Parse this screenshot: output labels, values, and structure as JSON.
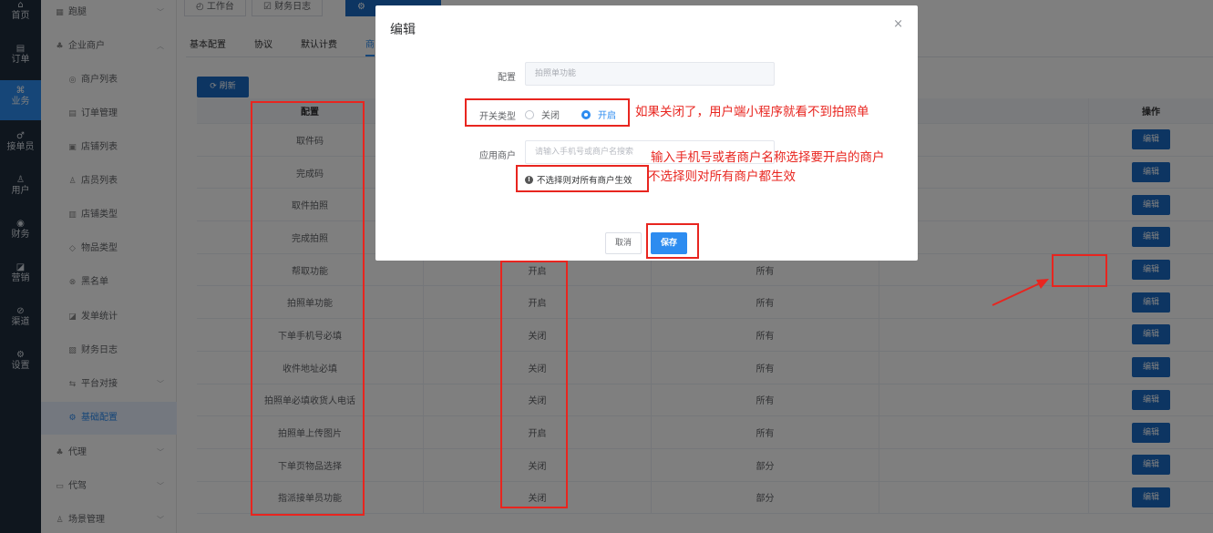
{
  "mainbar": {
    "items": [
      {
        "icon": "home-icon",
        "glyph": "⌂",
        "label": "首页"
      },
      {
        "icon": "order-icon",
        "glyph": "▤",
        "label": "订单"
      },
      {
        "icon": "business-icon",
        "glyph": "⌘",
        "label": "业务"
      },
      {
        "icon": "bike-icon",
        "glyph": "♂",
        "label": "接单员"
      },
      {
        "icon": "user-icon",
        "glyph": "♙",
        "label": "用户"
      },
      {
        "icon": "finance-icon",
        "glyph": "◉",
        "label": "财务"
      },
      {
        "icon": "marketing-icon",
        "glyph": "◪",
        "label": "营销"
      },
      {
        "icon": "channel-icon",
        "glyph": "⊘",
        "label": "渠道"
      },
      {
        "icon": "settings-icon",
        "glyph": "⚙",
        "label": "设置"
      }
    ],
    "active_index": 2
  },
  "sidebar": {
    "items": [
      {
        "label": "跑腿",
        "icon": "grid-icon",
        "glyph": "▦",
        "chevron": "﹀",
        "level": 1
      },
      {
        "label": "企业商户",
        "icon": "group-icon",
        "glyph": "♣",
        "chevron": "︿",
        "level": 1
      },
      {
        "label": "商户列表",
        "icon": "list-icon",
        "glyph": "◎",
        "level": 2
      },
      {
        "label": "订单管理",
        "icon": "order-icon",
        "glyph": "▤",
        "level": 2
      },
      {
        "label": "店铺列表",
        "icon": "shop-icon",
        "glyph": "▣",
        "level": 2
      },
      {
        "label": "店员列表",
        "icon": "user-icon",
        "glyph": "♙",
        "level": 2
      },
      {
        "label": "店铺类型",
        "icon": "type-icon",
        "glyph": "▥",
        "level": 2
      },
      {
        "label": "物品类型",
        "icon": "tag-icon",
        "glyph": "◇",
        "level": 2
      },
      {
        "label": "黑名单",
        "icon": "shield-icon",
        "glyph": "⊗",
        "level": 2
      },
      {
        "label": "发单统计",
        "icon": "chart-icon",
        "glyph": "◪",
        "level": 2
      },
      {
        "label": "财务日志",
        "icon": "log-icon",
        "glyph": "▧",
        "level": 2
      },
      {
        "label": "平台对接",
        "icon": "link-icon",
        "glyph": "⇆",
        "chevron": "﹀",
        "level": 2
      },
      {
        "label": "基础配置",
        "icon": "gear-icon",
        "glyph": "⚙",
        "level": 2,
        "active": true
      },
      {
        "label": "代理",
        "icon": "group-icon",
        "glyph": "♣",
        "chevron": "﹀",
        "level": 1
      },
      {
        "label": "代驾",
        "icon": "car-icon",
        "glyph": "▭",
        "chevron": "﹀",
        "level": 1
      },
      {
        "label": "场景管理",
        "icon": "user-icon",
        "glyph": "♙",
        "chevron": "﹀",
        "level": 1
      }
    ]
  },
  "page_tabs": [
    {
      "label": "◴ 工作台",
      "active": false
    },
    {
      "label": "☑ 财务日志",
      "active": false
    },
    {
      "label": "⚙",
      "active": true
    }
  ],
  "sub_tabs": [
    "基本配置",
    "协议",
    "默认计费",
    "商"
  ],
  "refresh_button": "⟳ 刷新",
  "table": {
    "headers": [
      "配置",
      "",
      "",
      "",
      "操作"
    ],
    "edit_label": "编辑",
    "rows": [
      {
        "config": "取件码",
        "status": "",
        "scope": ""
      },
      {
        "config": "完成码",
        "status": "",
        "scope": ""
      },
      {
        "config": "取件拍照",
        "status": "",
        "scope": ""
      },
      {
        "config": "完成拍照",
        "status": "",
        "scope": ""
      },
      {
        "config": "帮取功能",
        "status": "开启",
        "scope": "所有"
      },
      {
        "config": "拍照单功能",
        "status": "开启",
        "scope": "所有"
      },
      {
        "config": "下单手机号必填",
        "status": "关闭",
        "scope": "所有"
      },
      {
        "config": "收件地址必填",
        "status": "关闭",
        "scope": "所有"
      },
      {
        "config": "拍照单必填收货人电话",
        "status": "关闭",
        "scope": "所有"
      },
      {
        "config": "拍照单上传图片",
        "status": "开启",
        "scope": "所有"
      },
      {
        "config": "下单页物品选择",
        "status": "关闭",
        "scope": "部分"
      },
      {
        "config": "指派接单员功能",
        "status": "关闭",
        "scope": "部分"
      }
    ]
  },
  "dialog": {
    "title": "编辑",
    "close": "×",
    "config_label": "配置",
    "config_value": "拍照单功能",
    "switch_label": "开关类型",
    "option_off": "关闭",
    "option_on": "开启",
    "selected": "开启",
    "merchant_label": "应用商户",
    "merchant_placeholder": "请输入手机号或商户名搜索",
    "hint_icon": "!",
    "hint": "不选择则对所有商户生效",
    "cancel": "取消",
    "save": "保存"
  },
  "annotations": {
    "note1": "如果关闭了，用户端小程序就看不到拍照单",
    "note2": "输入手机号或者商户名称选择要开启的商户",
    "note3": "不选择则对所有商户都生效",
    "color": "#e8251f"
  },
  "colors": {
    "accent": "#2d8cf0",
    "button": "#1b6bc4",
    "sidebar_dark": "#1f2d3d"
  }
}
